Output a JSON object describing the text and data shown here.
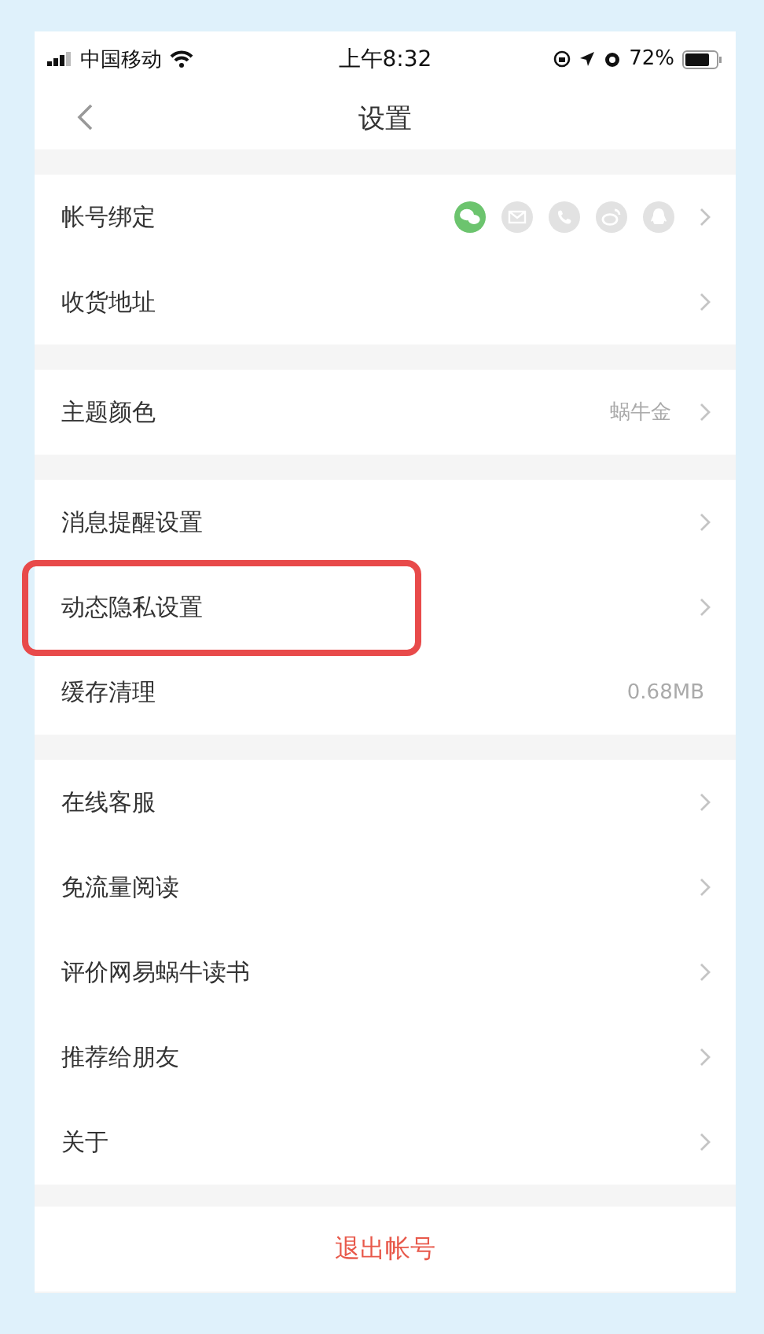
{
  "status_bar": {
    "carrier": "中国移动",
    "time": "上午8:32",
    "battery": "72%"
  },
  "nav": {
    "title": "设置"
  },
  "sections": [
    {
      "rows": [
        {
          "label": "帐号绑定",
          "chevron": true,
          "highlighted": false,
          "accounts": [
            {
              "kind": "wechat",
              "bound": true
            },
            {
              "kind": "mail",
              "bound": false
            },
            {
              "kind": "phone",
              "bound": false
            },
            {
              "kind": "weibo",
              "bound": false
            },
            {
              "kind": "qq",
              "bound": false
            }
          ]
        },
        {
          "label": "收货地址",
          "chevron": true,
          "highlighted": false
        }
      ]
    },
    {
      "rows": [
        {
          "label": "主题颜色",
          "value": "蜗牛金",
          "chevron": true,
          "highlighted": false
        }
      ]
    },
    {
      "rows": [
        {
          "label": "消息提醒设置",
          "chevron": true,
          "highlighted": false
        },
        {
          "label": "动态隐私设置",
          "chevron": true,
          "highlighted": true
        },
        {
          "label": "缓存清理",
          "value": "0.68MB",
          "chevron": false,
          "highlighted": false
        }
      ]
    },
    {
      "rows": [
        {
          "label": "在线客服",
          "chevron": true,
          "highlighted": false
        },
        {
          "label": "免流量阅读",
          "chevron": true,
          "highlighted": false
        },
        {
          "label": "评价网易蜗牛读书",
          "chevron": true,
          "highlighted": false
        },
        {
          "label": "推荐给朋友",
          "chevron": true,
          "highlighted": false
        },
        {
          "label": "关于",
          "chevron": true,
          "highlighted": false
        }
      ]
    }
  ],
  "logout": {
    "label": "退出帐号"
  }
}
